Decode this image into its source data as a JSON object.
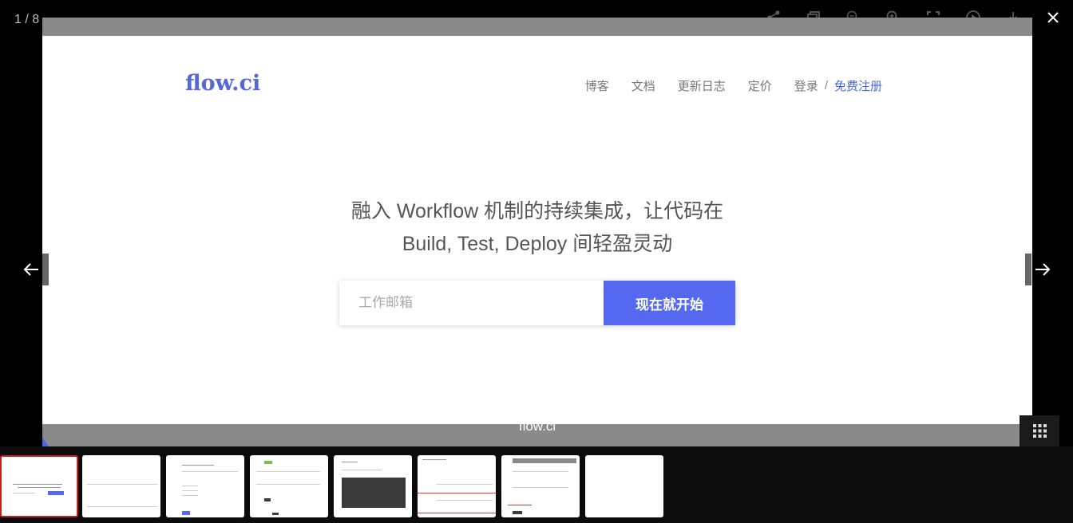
{
  "viewer": {
    "counter": "1 / 8",
    "toolbar": [
      {
        "name": "share-icon"
      },
      {
        "name": "actual-size-icon"
      },
      {
        "name": "zoom-out-icon"
      },
      {
        "name": "zoom-in-icon"
      },
      {
        "name": "fullscreen-icon"
      },
      {
        "name": "play-icon"
      },
      {
        "name": "download-icon"
      },
      {
        "name": "close-icon"
      }
    ],
    "caption": "flow.ci",
    "thumbnail_count": 8,
    "active_thumbnail": 1
  },
  "site": {
    "logo": "flow.ci",
    "nav": {
      "blog": "博客",
      "docs": "文档",
      "changelog": "更新日志",
      "pricing": "定价",
      "login": "登录",
      "separator": "/",
      "signup": "免费注册"
    },
    "hero": {
      "line1": "融入 Workflow 机制的持续集成，让代码在",
      "line2": "Build, Test, Deploy 间轻盈灵动"
    },
    "form": {
      "email_placeholder": "工作邮箱",
      "submit_label": "现在就开始"
    }
  },
  "colors": {
    "brand": "#5468d8",
    "accent_button": "#5468f0",
    "active_thumb_border": "#c62020",
    "caption_bar": "#8a8a8a"
  }
}
